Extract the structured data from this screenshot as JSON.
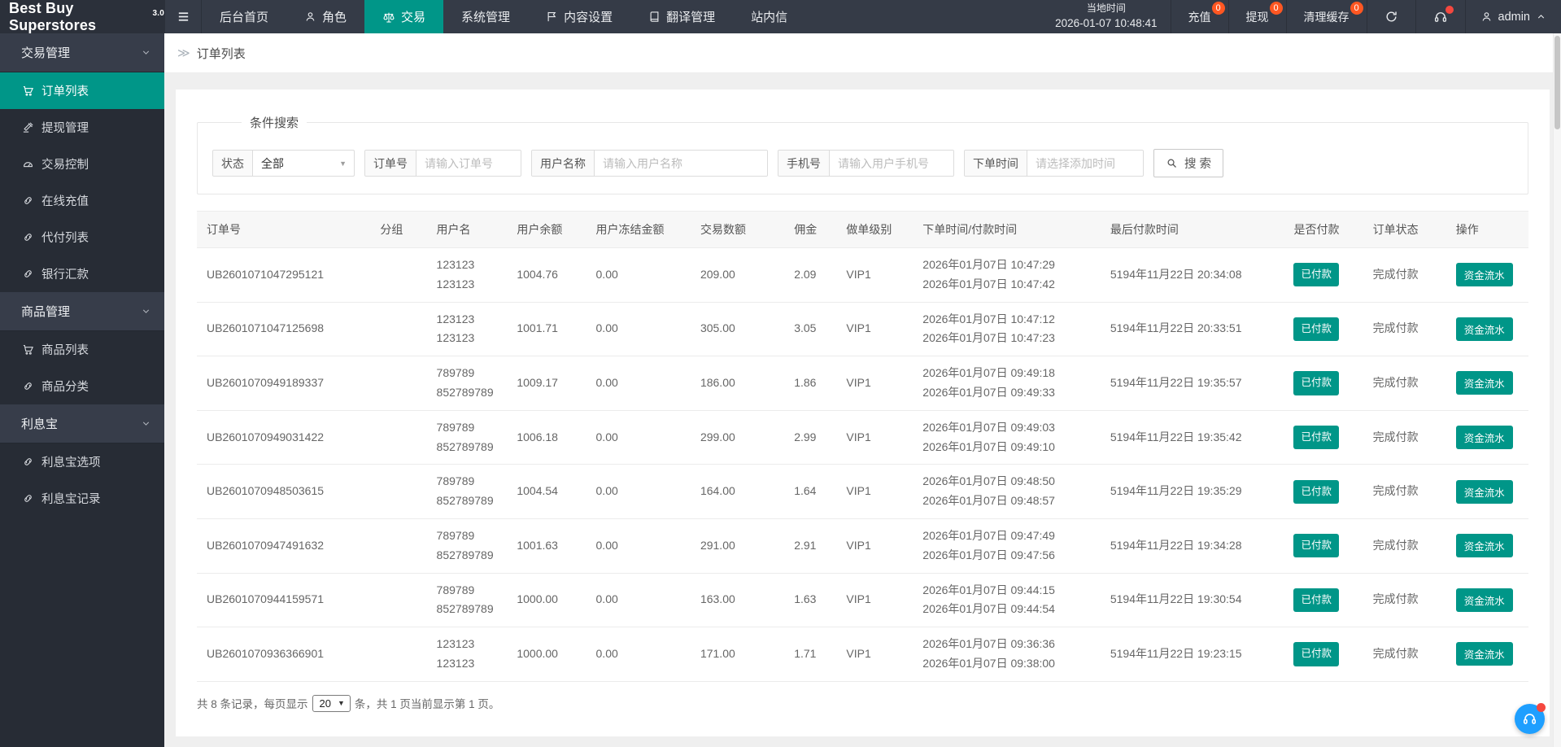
{
  "brand": {
    "name": "Best Buy Superstores",
    "version": "3.0"
  },
  "topnav": {
    "items": [
      {
        "label": "后台首页",
        "icon": "none"
      },
      {
        "label": "角色",
        "icon": "person-icon"
      },
      {
        "label": "交易",
        "icon": "scales-icon",
        "active": true
      },
      {
        "label": "系统管理",
        "icon": "none"
      },
      {
        "label": "内容设置",
        "icon": "flag-icon"
      },
      {
        "label": "翻译管理",
        "icon": "book-icon"
      },
      {
        "label": "站内信",
        "icon": "none"
      }
    ]
  },
  "topbar_right": {
    "local_time_label": "当地时间",
    "local_time": "2026-01-07 10:48:41",
    "recharge": {
      "label": "充值",
      "badge": "0"
    },
    "withdraw": {
      "label": "提现",
      "badge": "0"
    },
    "clear_cache": {
      "label": "清理缓存",
      "badge": "0"
    },
    "refresh_icon": "refresh-icon",
    "support_icon": "headset-icon",
    "user": {
      "name": "admin",
      "icon": "person-icon",
      "chevron": "chevron-up-icon"
    }
  },
  "sidebar": {
    "items": [
      {
        "type": "group",
        "label": "交易管理",
        "icon": "chevron-down-icon"
      },
      {
        "type": "item",
        "label": "订单列表",
        "icon": "cart-icon",
        "active": true
      },
      {
        "type": "item",
        "label": "提现管理",
        "icon": "gavel-icon"
      },
      {
        "type": "item",
        "label": "交易控制",
        "icon": "gauge-icon"
      },
      {
        "type": "item",
        "label": "在线充值",
        "icon": "link-icon"
      },
      {
        "type": "item",
        "label": "代付列表",
        "icon": "link-icon"
      },
      {
        "type": "item",
        "label": "银行汇款",
        "icon": "link-icon"
      },
      {
        "type": "group",
        "label": "商品管理",
        "icon": "chevron-down-icon"
      },
      {
        "type": "item",
        "label": "商品列表",
        "icon": "cart-icon"
      },
      {
        "type": "item",
        "label": "商品分类",
        "icon": "link-icon"
      },
      {
        "type": "group",
        "label": "利息宝",
        "icon": "chevron-down-icon"
      },
      {
        "type": "item",
        "label": "利息宝选项",
        "icon": "link-icon"
      },
      {
        "type": "item",
        "label": "利息宝记录",
        "icon": "link-icon"
      }
    ]
  },
  "breadcrumb": {
    "separator": "≫",
    "title": "订单列表"
  },
  "search_panel": {
    "legend": "条件搜索",
    "status": {
      "label": "状态",
      "value": "全部"
    },
    "fields": [
      {
        "label": "订单号",
        "placeholder": "请输入订单号"
      },
      {
        "label": "用户名称",
        "placeholder": "请输入用户名称"
      },
      {
        "label": "手机号",
        "placeholder": "请输入用户手机号"
      },
      {
        "label": "下单时间",
        "placeholder": "请选择添加时间"
      }
    ],
    "search_button": "搜 索",
    "search_icon": "search-icon"
  },
  "table": {
    "headers": [
      "订单号",
      "分组",
      "用户名",
      "用户余额",
      "用户冻结金额",
      "交易数额",
      "佣金",
      "做单级别",
      "下单时间/付款时间",
      "最后付款时间",
      "是否付款",
      "订单状态",
      "操作"
    ],
    "rows": [
      {
        "order_no": "UB2601071047295121",
        "group": "",
        "username": [
          "123123",
          "123123"
        ],
        "balance": "1004.76",
        "frozen": "0.00",
        "amount": "209.00",
        "commission": "2.09",
        "level": "VIP1",
        "order_pay_time": [
          "2026年01月07日 10:47:29",
          "2026年01月07日 10:47:42"
        ],
        "last_pay_time": "5194年11月22日 20:34:08",
        "paid": "已付款",
        "status": "完成付款",
        "action": "资金流水"
      },
      {
        "order_no": "UB2601071047125698",
        "group": "",
        "username": [
          "123123",
          "123123"
        ],
        "balance": "1001.71",
        "frozen": "0.00",
        "amount": "305.00",
        "commission": "3.05",
        "level": "VIP1",
        "order_pay_time": [
          "2026年01月07日 10:47:12",
          "2026年01月07日 10:47:23"
        ],
        "last_pay_time": "5194年11月22日 20:33:51",
        "paid": "已付款",
        "status": "完成付款",
        "action": "资金流水"
      },
      {
        "order_no": "UB2601070949189337",
        "group": "",
        "username": [
          "789789",
          "852789789"
        ],
        "balance": "1009.17",
        "frozen": "0.00",
        "amount": "186.00",
        "commission": "1.86",
        "level": "VIP1",
        "order_pay_time": [
          "2026年01月07日 09:49:18",
          "2026年01月07日 09:49:33"
        ],
        "last_pay_time": "5194年11月22日 19:35:57",
        "paid": "已付款",
        "status": "完成付款",
        "action": "资金流水"
      },
      {
        "order_no": "UB2601070949031422",
        "group": "",
        "username": [
          "789789",
          "852789789"
        ],
        "balance": "1006.18",
        "frozen": "0.00",
        "amount": "299.00",
        "commission": "2.99",
        "level": "VIP1",
        "order_pay_time": [
          "2026年01月07日 09:49:03",
          "2026年01月07日 09:49:10"
        ],
        "last_pay_time": "5194年11月22日 19:35:42",
        "paid": "已付款",
        "status": "完成付款",
        "action": "资金流水"
      },
      {
        "order_no": "UB2601070948503615",
        "group": "",
        "username": [
          "789789",
          "852789789"
        ],
        "balance": "1004.54",
        "frozen": "0.00",
        "amount": "164.00",
        "commission": "1.64",
        "level": "VIP1",
        "order_pay_time": [
          "2026年01月07日 09:48:50",
          "2026年01月07日 09:48:57"
        ],
        "last_pay_time": "5194年11月22日 19:35:29",
        "paid": "已付款",
        "status": "完成付款",
        "action": "资金流水"
      },
      {
        "order_no": "UB2601070947491632",
        "group": "",
        "username": [
          "789789",
          "852789789"
        ],
        "balance": "1001.63",
        "frozen": "0.00",
        "amount": "291.00",
        "commission": "2.91",
        "level": "VIP1",
        "order_pay_time": [
          "2026年01月07日 09:47:49",
          "2026年01月07日 09:47:56"
        ],
        "last_pay_time": "5194年11月22日 19:34:28",
        "paid": "已付款",
        "status": "完成付款",
        "action": "资金流水"
      },
      {
        "order_no": "UB2601070944159571",
        "group": "",
        "username": [
          "789789",
          "852789789"
        ],
        "balance": "1000.00",
        "frozen": "0.00",
        "amount": "163.00",
        "commission": "1.63",
        "level": "VIP1",
        "order_pay_time": [
          "2026年01月07日 09:44:15",
          "2026年01月07日 09:44:54"
        ],
        "last_pay_time": "5194年11月22日 19:30:54",
        "paid": "已付款",
        "status": "完成付款",
        "action": "资金流水"
      },
      {
        "order_no": "UB2601070936366901",
        "group": "",
        "username": [
          "123123",
          "123123"
        ],
        "balance": "1000.00",
        "frozen": "0.00",
        "amount": "171.00",
        "commission": "1.71",
        "level": "VIP1",
        "order_pay_time": [
          "2026年01月07日 09:36:36",
          "2026年01月07日 09:38:00"
        ],
        "last_pay_time": "5194年11月22日 19:23:15",
        "paid": "已付款",
        "status": "完成付款",
        "action": "资金流水"
      }
    ]
  },
  "pagination": {
    "prefix": "共 8 条记录，每页显示",
    "page_size": "20",
    "suffix": "条，共 1 页当前显示第 1 页。"
  },
  "colors": {
    "accent_teal": "#009688",
    "badge_orange": "#ff5722",
    "support_blue": "#1e9fff",
    "alert_red": "#f5483f",
    "topbar_dark": "#353b47",
    "sidebar_dark": "#272c35"
  }
}
